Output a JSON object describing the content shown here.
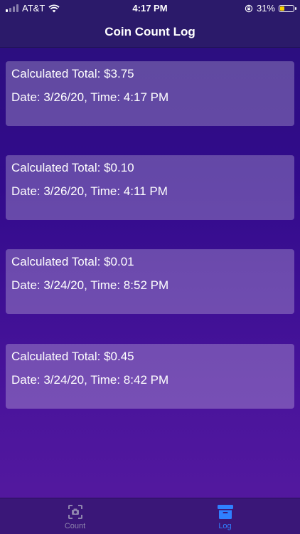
{
  "status_bar": {
    "carrier": "AT&T",
    "time": "4:17 PM",
    "battery_percent": "31%",
    "battery_level": 0.31,
    "icons": [
      "signal-icon",
      "wifi-icon",
      "orientation-lock-icon",
      "battery-icon"
    ]
  },
  "nav": {
    "title": "Coin Count Log"
  },
  "log_entries": [
    {
      "total": "Calculated Total: $3.75",
      "datetime": "Date: 3/26/20, Time: 4:17 PM"
    },
    {
      "total": "Calculated Total: $0.10",
      "datetime": "Date: 3/26/20, Time: 4:11 PM"
    },
    {
      "total": "Calculated Total: $0.01",
      "datetime": "Date: 3/24/20, Time: 8:52 PM"
    },
    {
      "total": "Calculated Total: $0.45",
      "datetime": "Date: 3/24/20, Time: 8:42 PM"
    }
  ],
  "tabs": [
    {
      "label": "Count",
      "icon": "camera-icon",
      "active": false
    },
    {
      "label": "Log",
      "icon": "archive-box-icon",
      "active": true
    }
  ],
  "colors": {
    "bar_background": "#2b1a6a",
    "active_tab": "#2f80ff",
    "inactive_tab": "#8e84ad",
    "battery_fill": "#f5d000"
  }
}
